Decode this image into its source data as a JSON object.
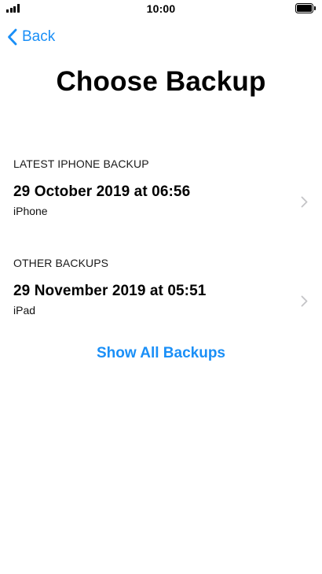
{
  "status_bar": {
    "time": "10:00"
  },
  "nav": {
    "back_label": "Back"
  },
  "title": "Choose Backup",
  "sections": [
    {
      "header": "LATEST IPHONE BACKUP",
      "backup": {
        "date": "29 October 2019 at 06:56",
        "device": "iPhone"
      }
    },
    {
      "header": "OTHER BACKUPS",
      "backup": {
        "date": "29 November 2019 at 05:51",
        "device": "iPad"
      }
    }
  ],
  "show_all_label": "Show All Backups",
  "colors": {
    "accent": "#1a8ff7",
    "chevron": "#c4c4c7",
    "text": "#000000",
    "background": "#ffffff"
  },
  "icons": [
    "cellular-signal-icon",
    "battery-icon",
    "chevron-left-icon",
    "chevron-right-icon"
  ]
}
